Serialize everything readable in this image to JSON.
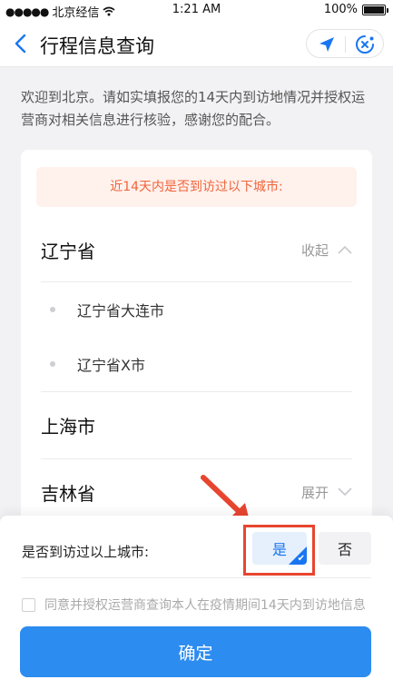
{
  "status_bar": {
    "carrier": "北京经信",
    "time": "1:21 AM",
    "battery": "100%",
    "signal_icon": "signal-dots-icon",
    "wifi_icon": "wifi-icon"
  },
  "nav": {
    "title": "行程信息查询",
    "back_icon": "chevron-left-icon",
    "location_icon": "location-arrow-icon",
    "close_icon": "close-circle-icon"
  },
  "intro_text": "欢迎到北京。请如实填报您的14天内到访地情况并授权运营商对相关信息进行核验，感谢您的配合。",
  "card": {
    "notice": "近14天内是否到访过以下城市:",
    "provinces": [
      {
        "name": "辽宁省",
        "toggle_label": "收起",
        "expanded": true,
        "cities": [
          "辽宁省大连市",
          "辽宁省X市"
        ]
      },
      {
        "name": "上海市",
        "toggle_label": "",
        "expanded": false,
        "cities": []
      },
      {
        "name": "吉林省",
        "toggle_label": "展开",
        "expanded": false,
        "cities": []
      }
    ]
  },
  "bottom": {
    "question": "是否到访过以上城市:",
    "yes_label": "是",
    "no_label": "否",
    "selected": "yes",
    "consent_text": "同意并授权运营商查询本人在疫情期间14天内到访地信息",
    "confirm_label": "确定"
  },
  "colors": {
    "accent": "#2d8cf0",
    "selected_bg": "#e6f0fc",
    "notice_text": "#f0643c",
    "notice_bg": "#fff1ec",
    "annotation_red": "#e8452f"
  }
}
